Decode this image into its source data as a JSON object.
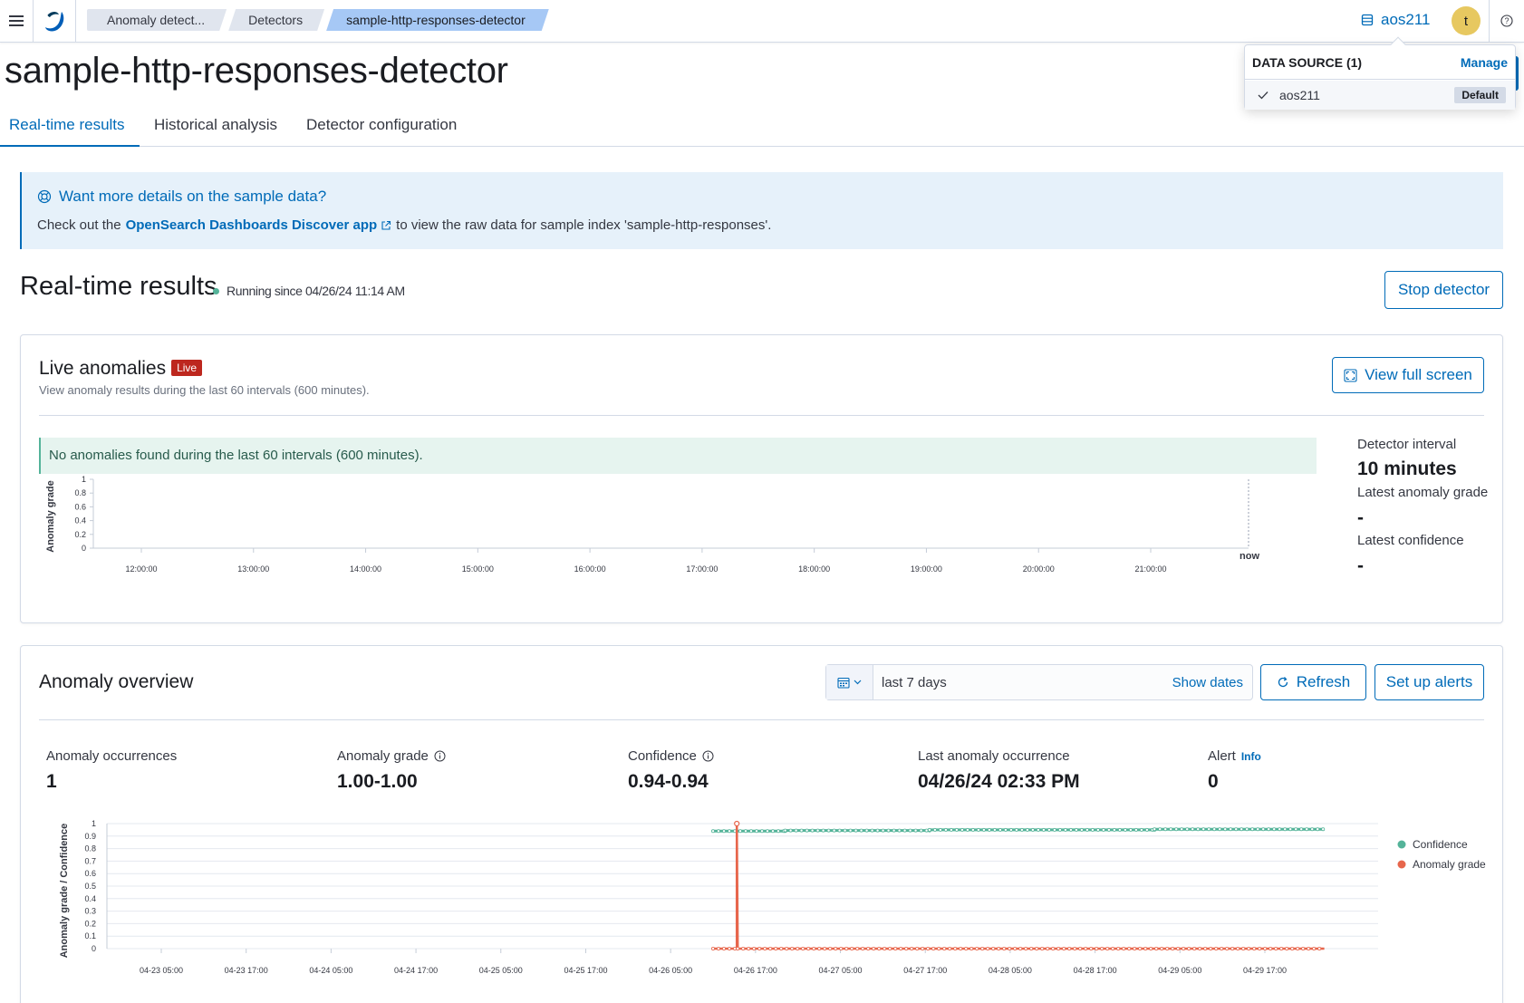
{
  "breadcrumbs": [
    "Anomaly detect...",
    "Detectors",
    "sample-http-responses-detector"
  ],
  "header": {
    "data_source_label": "aos211",
    "avatar_initial": "t"
  },
  "datasource_popover": {
    "title": "DATA SOURCE (1)",
    "manage_label": "Manage",
    "items": [
      {
        "label": "aos211",
        "badge": "Default"
      }
    ]
  },
  "page_title": "sample-http-responses-detector",
  "tabs": [
    "Real-time results",
    "Historical analysis",
    "Detector configuration"
  ],
  "callout": {
    "title": "Want more details on the sample data?",
    "text_before": "Check out the",
    "link": "OpenSearch Dashboards Discover app",
    "text_after": "to view the raw data for sample index 'sample-http-responses'."
  },
  "realtime": {
    "title": "Real-time results",
    "status": "Running since 04/26/24 11:14 AM",
    "stop_label": "Stop detector"
  },
  "live": {
    "title": "Live anomalies",
    "badge": "Live",
    "subtitle": "View anomaly results during the last 60 intervals (600 minutes).",
    "fullscreen_label": "View full screen",
    "notice": "No anomalies found during the last 60 intervals (600 minutes).",
    "y_label": "Anomaly grade",
    "now_label": "now",
    "stats": {
      "interval_label": "Detector interval",
      "interval_value": "10 minutes",
      "grade_label": "Latest anomaly grade",
      "grade_value": "-",
      "confidence_label": "Latest confidence",
      "confidence_value": "-"
    }
  },
  "overview": {
    "title": "Anomaly overview",
    "date_range": "last 7 days",
    "show_dates_label": "Show dates",
    "refresh_label": "Refresh",
    "alerts_label": "Set up alerts",
    "stats": [
      {
        "label": "Anomaly occurrences",
        "value": "1"
      },
      {
        "label": "Anomaly grade",
        "value": "1.00-1.00"
      },
      {
        "label": "Confidence",
        "value": "0.94-0.94"
      },
      {
        "label": "Last anomaly occurrence",
        "value": "04/26/24 02:33 PM"
      },
      {
        "label": "Alert",
        "value": "0",
        "info": "Info"
      }
    ],
    "y_label": "Anomaly grade / Confidence"
  },
  "colors": {
    "accent": "#006bb8",
    "confidence": "#54b399",
    "anomaly": "#e7664c",
    "live_badge": "#bd271e"
  },
  "chart_data": [
    {
      "type": "line",
      "title": "Live anomalies",
      "ylabel": "Anomaly grade",
      "ylim": [
        0,
        1
      ],
      "yticks": [
        "0",
        "0.2",
        "0.4",
        "0.6",
        "0.8",
        "1"
      ],
      "x_ticks": [
        "12:00:00",
        "13:00:00",
        "14:00:00",
        "15:00:00",
        "16:00:00",
        "17:00:00",
        "18:00:00",
        "19:00:00",
        "20:00:00",
        "21:00:00"
      ],
      "series": []
    },
    {
      "type": "line",
      "title": "Anomaly overview",
      "ylabel": "Anomaly grade / Confidence",
      "ylim": [
        0,
        1
      ],
      "yticks": [
        "0",
        "0.1",
        "0.2",
        "0.3",
        "0.4",
        "0.5",
        "0.6",
        "0.7",
        "0.8",
        "0.9",
        "1"
      ],
      "x_ticks": [
        "04-23 05:00",
        "04-23 17:00",
        "04-24 05:00",
        "04-24 17:00",
        "04-25 05:00",
        "04-25 17:00",
        "04-26 05:00",
        "04-26 17:00",
        "04-27 05:00",
        "04-27 17:00",
        "04-28 05:00",
        "04-28 17:00",
        "04-29 05:00",
        "04-29 17:00"
      ],
      "legend_position": "right",
      "series": [
        {
          "name": "Confidence",
          "points": [
            [
              6.5,
              0.94
            ],
            [
              7.35,
              0.94
            ],
            [
              7.35,
              0.945
            ],
            [
              9.05,
              0.945
            ],
            [
              9.05,
              0.95
            ],
            [
              11.7,
              0.95
            ],
            [
              11.7,
              0.955
            ],
            [
              13.7,
              0.955
            ]
          ]
        },
        {
          "name": "Anomaly grade",
          "points": [
            [
              6.5,
              0
            ],
            [
              6.78,
              0
            ],
            [
              6.78,
              1
            ],
            [
              6.79,
              0
            ],
            [
              13.7,
              0
            ]
          ]
        }
      ]
    }
  ]
}
